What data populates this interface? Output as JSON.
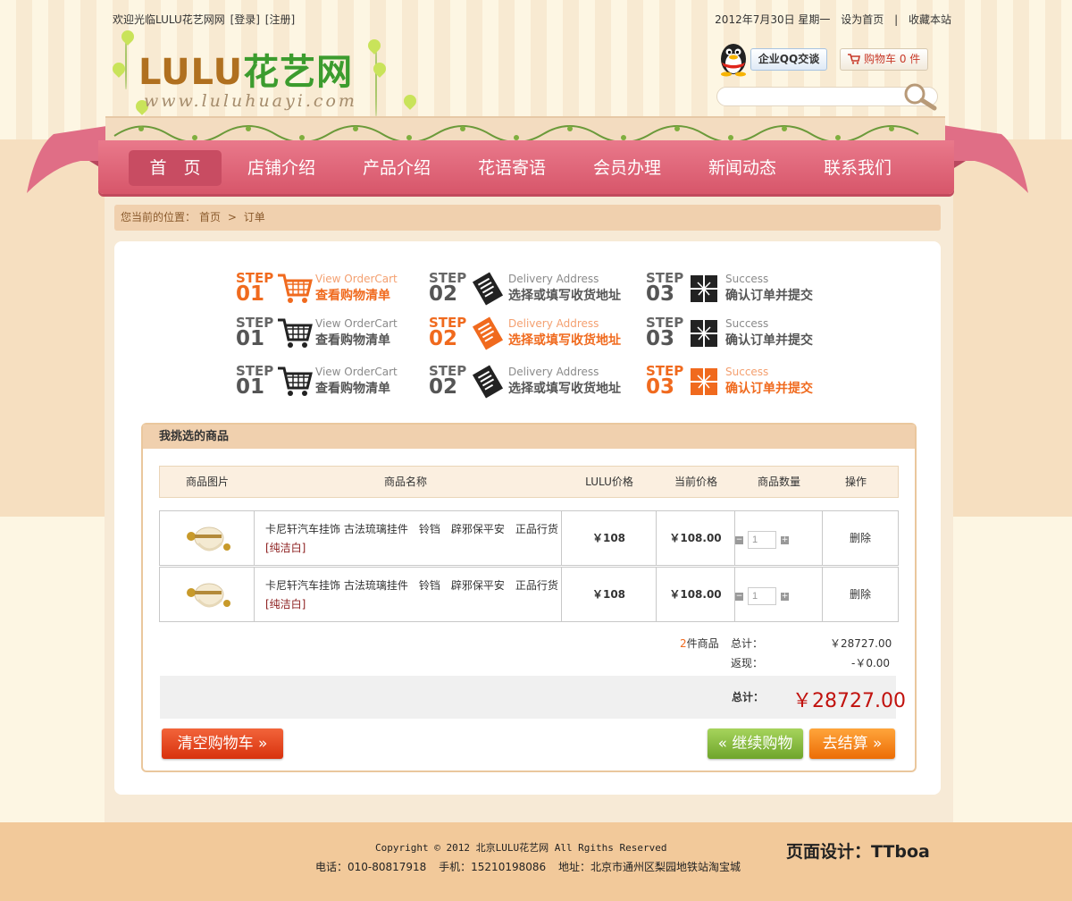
{
  "topbar": {
    "welcome": "欢迎光临LULU花艺网网",
    "login": "[登录]",
    "register": "[注册]",
    "date": "2012年7月30日 星期一",
    "set_home": "设为首页",
    "sep": "|",
    "bookmark": "收藏本站"
  },
  "logo": {
    "brand": "LULU",
    "brand_cn": "花艺网",
    "url": "www.luluhuayi.com"
  },
  "qq": {
    "label": "企业QQ交谈"
  },
  "cart": {
    "label": "购物车 0 件"
  },
  "search": {
    "placeholder": ""
  },
  "nav": [
    "首　页",
    "店铺介绍",
    "产品介绍",
    "花语寄语",
    "会员办理",
    "新闻动态",
    "联系我们"
  ],
  "breadcrumb": {
    "prefix": "您当前的位置：",
    "home": "首页",
    "sep": ">",
    "current": "订单"
  },
  "steps": {
    "word": "STEP",
    "items": [
      {
        "num": "01",
        "en": "View OrderCart",
        "cn": "查看购物清单"
      },
      {
        "num": "02",
        "en": "Delivery Address",
        "cn": "选择或填写收货地址"
      },
      {
        "num": "03",
        "en": "Success",
        "cn": "确认订单并提交"
      }
    ]
  },
  "goods": {
    "title": "我挑选的商品",
    "headers": [
      "商品图片",
      "商品名称",
      "LULU价格",
      "当前价格",
      "商品数量",
      "操作"
    ],
    "rows": [
      {
        "name": "卡尼轩汽车挂饰 古法琉璃挂件　铃铛　辟邪保平安　正品行货",
        "color": "[纯洁白]",
        "lulu_price": "￥108",
        "current_price": "￥108.00",
        "qty": "1",
        "action": "删除"
      },
      {
        "name": "卡尼轩汽车挂饰 古法琉璃挂件　铃铛　辟邪保平安　正品行货",
        "color": "[纯洁白]",
        "lulu_price": "￥108",
        "current_price": "￥108.00",
        "qty": "1",
        "action": "删除"
      }
    ],
    "count": "2",
    "count_unit": "件商品",
    "subtotal_label": "总计：",
    "subtotal_value": "￥28727.00",
    "rebate_label": "返现：",
    "rebate_value": "-￥0.00",
    "total_label": "总计：",
    "total_value": "￥28727.00"
  },
  "buttons": {
    "clear": "清空购物车",
    "continue": "继续购物",
    "checkout": "去结算"
  },
  "footer": {
    "copyright": "Copyright © 2012 北京LULU花艺网 All Rgiths Reserved",
    "tel": "电话：010-80817918",
    "mobile": "手机：15210198086",
    "address": "地址：北京市通州区梨园地铁站淘宝城",
    "design": "页面设计：TTboa"
  },
  "colors": {
    "nav": "#d7566a",
    "accent_orange": "#f06a1e",
    "total_red": "#c1120e",
    "crumb": "#f0d0ae"
  }
}
